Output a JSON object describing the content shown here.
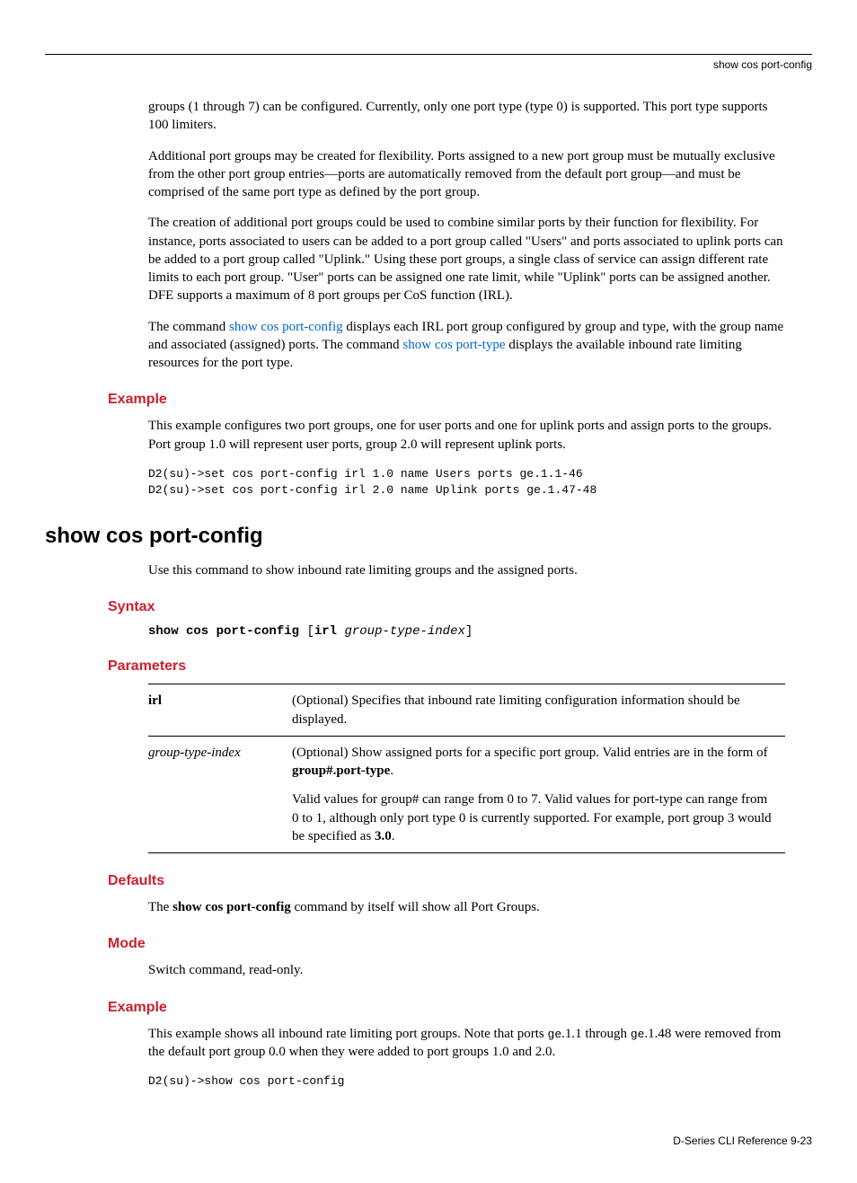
{
  "header": {
    "right": "show cos port-config"
  },
  "intro": {
    "p1": "groups (1 through 7) can be configured. Currently, only one port type (type 0) is supported. This port type supports 100 limiters.",
    "p2": "Additional port groups may be created for flexibility. Ports assigned to a new port group must be mutually exclusive from the other port group entries—ports are automatically removed from the default port group—and must be comprised of the same port type as defined by the port group.",
    "p3": "The creation of additional port groups could be used to combine similar ports by their function for flexibility. For instance, ports associated to users can be added to a port group called \"Users\" and ports associated to uplink ports can be added to a port group called \"Uplink.\" Using these port groups, a single class of service can assign different rate limits to each port group. \"User\" ports can be assigned one rate limit, while \"Uplink\" ports can be assigned another. DFE supports a maximum of 8 port groups per CoS function (IRL).",
    "p4_a": "The command ",
    "p4_link1": "show cos port-config",
    "p4_b": " displays each IRL port group configured by group and type, with the group name and associated (assigned) ports. The command ",
    "p4_link2": "show cos port-type",
    "p4_c": " displays the available inbound rate limiting resources for the port type."
  },
  "example1": {
    "heading": "Example",
    "p": "This example configures two port groups, one for user ports and one for uplink ports and assign ports to the groups. Port group 1.0 will represent user ports, group 2.0 will represent uplink ports.",
    "code": "D2(su)->set cos port-config irl 1.0 name Users ports ge.1.1-46\nD2(su)->set cos port-config irl 2.0 name Uplink ports ge.1.47-48"
  },
  "command": {
    "title": "show cos port-config",
    "desc": "Use this command to show inbound rate limiting groups and the assigned ports."
  },
  "syntax": {
    "heading": "Syntax",
    "cmd": "show cos port-config",
    "opt_kw": "irl",
    "opt_arg": "group-type-index"
  },
  "parameters": {
    "heading": "Parameters",
    "rows": [
      {
        "name_bold": "irl",
        "desc1": "(Optional) Specifies that inbound rate limiting configuration information should be displayed."
      },
      {
        "name_italic": "group-type-index",
        "desc1_a": "(Optional) Show assigned ports for a specific port group. Valid entries are in the form of ",
        "desc1_b_bold": "group#.port-type",
        "desc1_c": ".",
        "desc2_a": "Valid values for group# can range from 0 to 7. Valid values for port-type can range from 0 to 1, although only port type 0 is currently supported. For example, port group 3 would be specified as ",
        "desc2_b_bold": "3.0",
        "desc2_c": "."
      }
    ]
  },
  "defaults": {
    "heading": "Defaults",
    "p_a": "The ",
    "p_bold": "show cos port-config",
    "p_b": " command by itself will show all Port Groups."
  },
  "mode": {
    "heading": "Mode",
    "p": "Switch command, read-only."
  },
  "example2": {
    "heading": "Example",
    "p_a": "This example shows all inbound rate limiting port groups. Note that ports ",
    "p_m1": "ge",
    "p_b": ".1.1 through ",
    "p_m2": "ge",
    "p_c": ".1.48 were removed from the default port group 0.0 when they were added to port groups 1.0 and 2.0.",
    "code": "D2(su)->show cos port-config"
  },
  "footer": {
    "text": "D-Series CLI Reference   9-23"
  }
}
